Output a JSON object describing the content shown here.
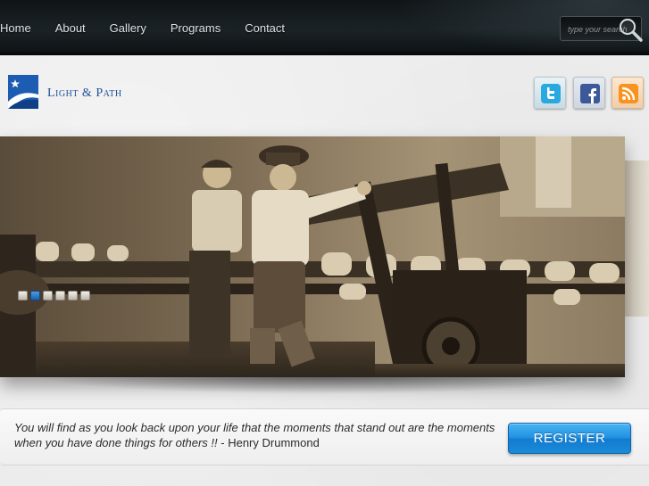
{
  "nav": {
    "items": [
      {
        "label": "Home"
      },
      {
        "label": "About"
      },
      {
        "label": "Gallery"
      },
      {
        "label": "Programs"
      },
      {
        "label": "Contact"
      }
    ],
    "search": {
      "placeholder": "type your search"
    }
  },
  "header": {
    "logo_text": "Light & Path",
    "social": [
      {
        "name": "twitter-icon",
        "color": "#2aa9e0"
      },
      {
        "name": "facebook-icon",
        "color": "#3b5998"
      },
      {
        "name": "rss-icon",
        "color": "#f7931e"
      }
    ]
  },
  "slider": {
    "slide_count": 6,
    "active_index": 1
  },
  "quote": {
    "text": "You will find as you look back upon your life that the moments that stand out are the moments when you have done things for others !!",
    "author": " - Henry Drummond"
  },
  "cta": {
    "register_label": "REGISTER"
  },
  "colors": {
    "brand_blue": "#1d4f9a",
    "button_blue": "#1f8fe0",
    "nav_bg": "#1b2226"
  }
}
